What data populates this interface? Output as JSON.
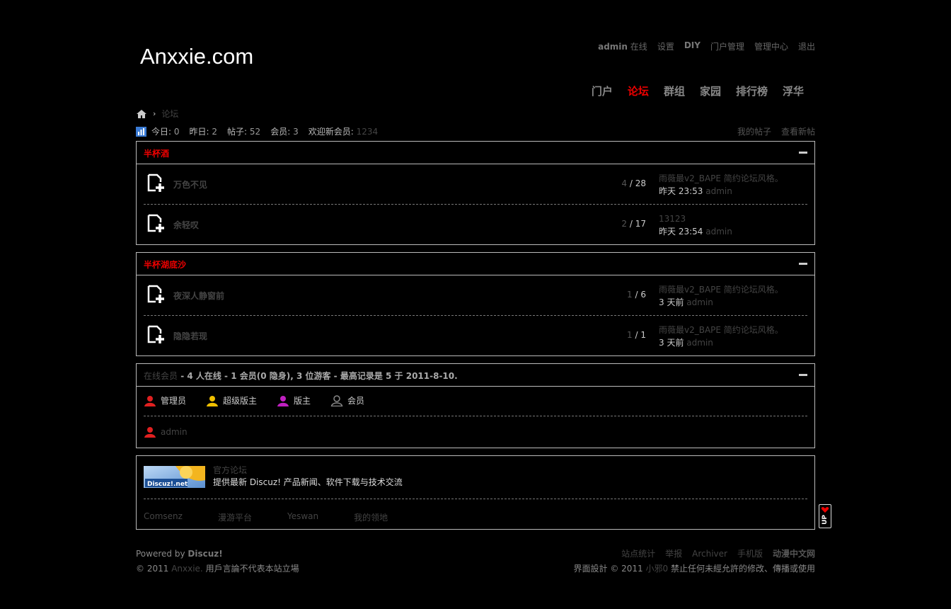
{
  "site": {
    "logo": "Anxxie.com"
  },
  "toplinks": {
    "user": "admin",
    "status": "在线",
    "items": [
      "设置",
      "DIY",
      "门户管理",
      "管理中心",
      "退出"
    ]
  },
  "nav": [
    "门户",
    "论坛",
    "群组",
    "家园",
    "排行榜",
    "浮华"
  ],
  "nav_active": "论坛",
  "breadcrumb": {
    "current": "论坛"
  },
  "stats": {
    "today_label": "今日:",
    "today": "0",
    "yesterday_label": "昨日:",
    "yesterday": "2",
    "posts_label": "帖子:",
    "posts": "52",
    "members_label": "会员:",
    "members": "3",
    "newmember_label": "欢迎新会员:",
    "newmember": "1234",
    "my_posts": "我的帖子",
    "new_posts": "查看新帖"
  },
  "categories": [
    {
      "title": "半杯酒",
      "forums": [
        {
          "name": "万色不见",
          "threads": "4",
          "posts": "28",
          "last_title": "雨薇最v2_BAPE 简约论坛风格。",
          "last_time": "昨天 23:53",
          "last_author": "admin"
        },
        {
          "name": "余轻叹",
          "threads": "2",
          "posts": "17",
          "last_title": "13123",
          "last_time": "昨天 23:54",
          "last_author": "admin"
        }
      ]
    },
    {
      "title": "半杯湖底沙",
      "forums": [
        {
          "name": "夜深人静窗前",
          "threads": "1",
          "posts": "6",
          "last_title": "雨薇最v2_BAPE 简约论坛风格。",
          "last_time": "3 天前",
          "last_author": "admin"
        },
        {
          "name": "隐隐若现",
          "threads": "1",
          "posts": "1",
          "last_title": "雨薇最v2_BAPE 简约论坛风格。",
          "last_time": "3 天前",
          "last_author": "admin"
        }
      ]
    }
  ],
  "online": {
    "label": "在线会员",
    "summary": " - 4 人在线 - 1 会员(0 隐身), 3 位游客 - 最高记录是 5 于 2011-8-10.",
    "legend": [
      {
        "label": "管理员",
        "color": "#e02020"
      },
      {
        "label": "超级版主",
        "color": "#f0c000"
      },
      {
        "label": "版主",
        "color": "#c020c0"
      },
      {
        "label": "会员",
        "color": "#888888"
      }
    ],
    "users": [
      {
        "name": "admin",
        "color": "#e02020"
      }
    ]
  },
  "links": {
    "logo_text": "Discuz!.net",
    "name": "官方论坛",
    "desc": "提供最新 Discuz! 产品新闻、软件下载与技术交流",
    "text_links": [
      "Comsenz",
      "漫游平台",
      "Yeswan",
      "我的领地"
    ]
  },
  "footer": {
    "powered": "Powered by",
    "powered_brand": "Discuz!",
    "copy_prefix": "© 2011",
    "copy_site": "Anxxie.",
    "copy_note": "用戶言論不代表本站立場",
    "links": [
      "站点统计",
      "举报",
      "Archiver",
      "手机版",
      "动漫中文网"
    ],
    "design_prefix": "界面設計 © 2011",
    "design_author": "小邪0",
    "design_note": "禁止任何未經允許的修改、傳播或使用"
  },
  "uptab": {
    "label": "UP"
  }
}
